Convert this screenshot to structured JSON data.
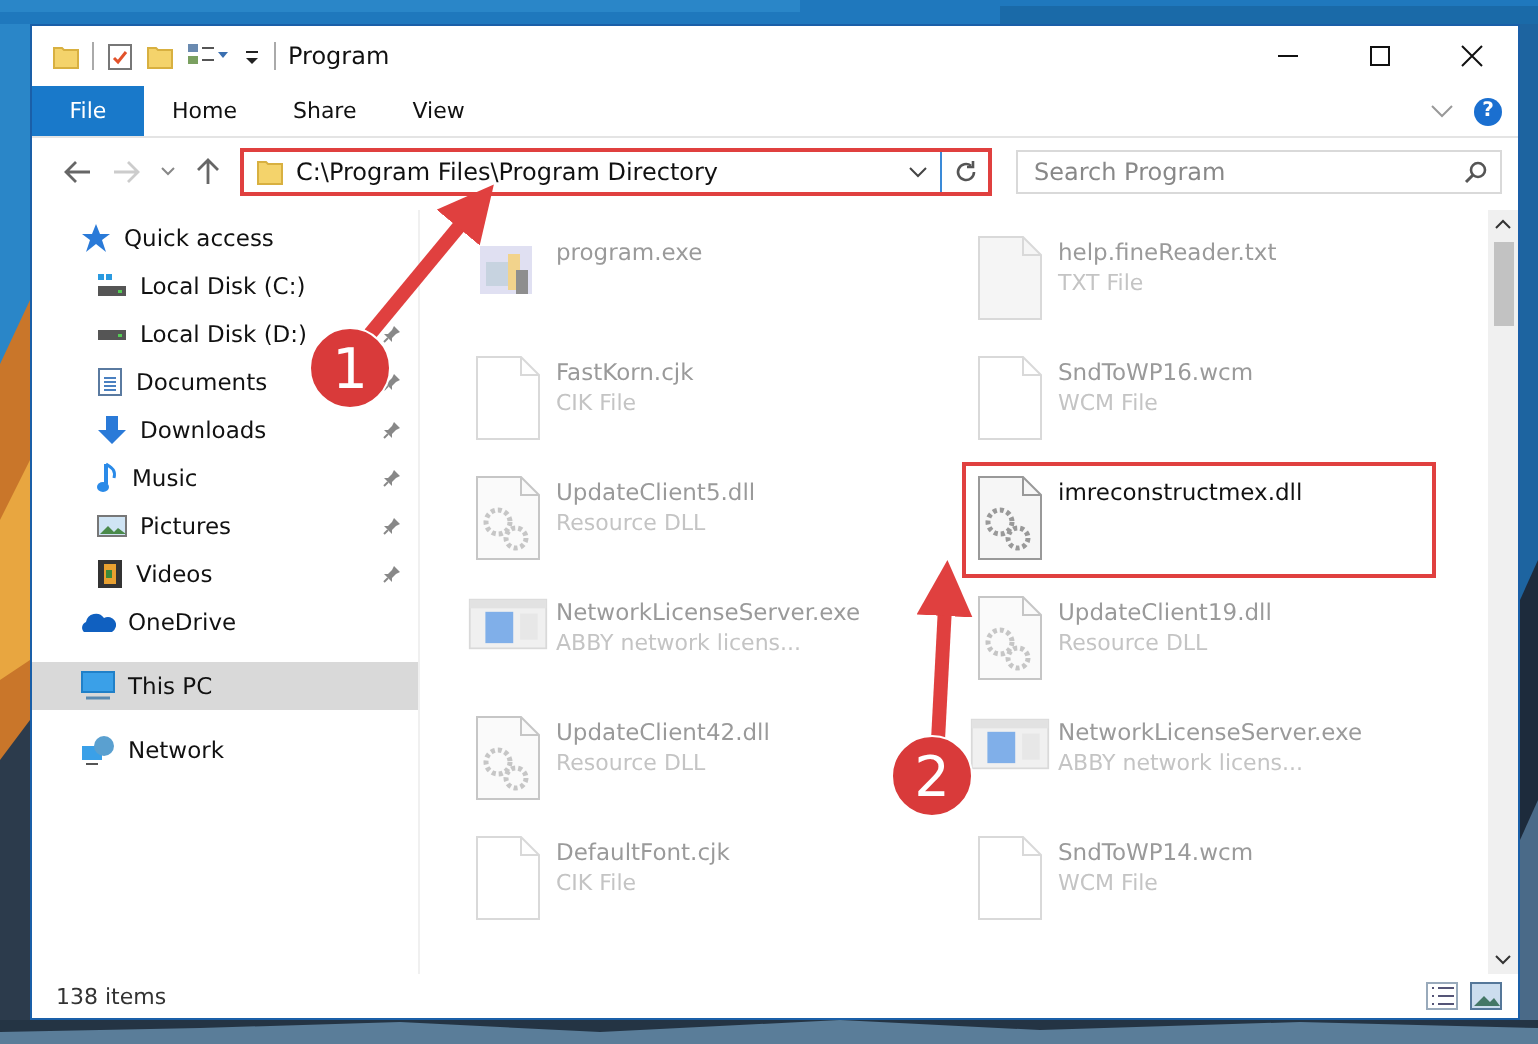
{
  "window": {
    "title": "Program"
  },
  "ribbon": {
    "tabs": [
      {
        "label": "File",
        "kind": "file"
      },
      {
        "label": "Home",
        "kind": "tab"
      },
      {
        "label": "Share",
        "kind": "tab"
      },
      {
        "label": "View",
        "kind": "tab"
      }
    ],
    "help": "?"
  },
  "address": {
    "path": "C:\\Program Files\\Program Directory",
    "highlighted": true
  },
  "search": {
    "placeholder": "Search Program"
  },
  "sidebar": {
    "items": [
      {
        "label": "Quick access",
        "kind": "star",
        "selected": false,
        "children": [
          {
            "label": "Local Disk (C:)",
            "kind": "drive-c",
            "pinned": false,
            "selected": false
          },
          {
            "label": "Local Disk (D:)",
            "kind": "drive",
            "pinned": true,
            "selected": false
          },
          {
            "label": "Documents",
            "kind": "documents",
            "pinned": true,
            "selected": false
          },
          {
            "label": "Downloads",
            "kind": "downloads",
            "pinned": true,
            "selected": false
          },
          {
            "label": "Music",
            "kind": "music",
            "pinned": true,
            "selected": false
          },
          {
            "label": "Pictures",
            "kind": "pictures",
            "pinned": true,
            "selected": false
          },
          {
            "label": "Videos",
            "kind": "videos",
            "pinned": true,
            "selected": false
          }
        ]
      },
      {
        "label": "OneDrive",
        "kind": "cloud",
        "selected": false
      },
      {
        "label": "This PC",
        "kind": "pc",
        "selected": true
      },
      {
        "label": "Network",
        "kind": "network",
        "selected": false
      }
    ]
  },
  "files": [
    {
      "name": "program.exe",
      "kind": "exe",
      "blurred": true,
      "highlighted": false
    },
    {
      "name": "help.fineReader.txt",
      "type": "TXT File",
      "kind": "text",
      "blurred": true,
      "highlighted": false
    },
    {
      "name": "FastKorn.cjk",
      "type": "CIK File",
      "kind": "blank",
      "blurred": true,
      "highlighted": false
    },
    {
      "name": "SndToWP16.wcm",
      "type": "WCM File",
      "kind": "blank",
      "blurred": true,
      "highlighted": false
    },
    {
      "name": "UpdateClient5.dll",
      "type": "Resource DLL",
      "kind": "dll",
      "blurred": true,
      "highlighted": false
    },
    {
      "name": "imreconstructmex.dll",
      "kind": "dll",
      "blurred": false,
      "highlighted": true
    },
    {
      "name": "NetworkLicenseServer.exe",
      "type": "ABBY network licens...",
      "kind": "app",
      "blurred": true,
      "highlighted": false
    },
    {
      "name": "UpdateClient19.dll",
      "type": "Resource DLL",
      "kind": "dll",
      "blurred": true,
      "highlighted": false
    },
    {
      "name": "UpdateClient42.dll",
      "type": "Resource DLL",
      "kind": "dll",
      "blurred": true,
      "highlighted": false
    },
    {
      "name": "NetworkLicenseServer.exe",
      "type": "ABBY network licens...",
      "kind": "app",
      "blurred": true,
      "highlighted": false
    },
    {
      "name": "DefaultFont.cjk",
      "type": "CIK File",
      "kind": "blank",
      "blurred": true,
      "highlighted": false
    },
    {
      "name": "SndToWP14.wcm",
      "type": "WCM File",
      "kind": "blank",
      "blurred": true,
      "highlighted": false
    }
  ],
  "status_bar": {
    "count": "138 items"
  },
  "callouts": [
    {
      "number": "1"
    },
    {
      "number": "2"
    }
  ]
}
